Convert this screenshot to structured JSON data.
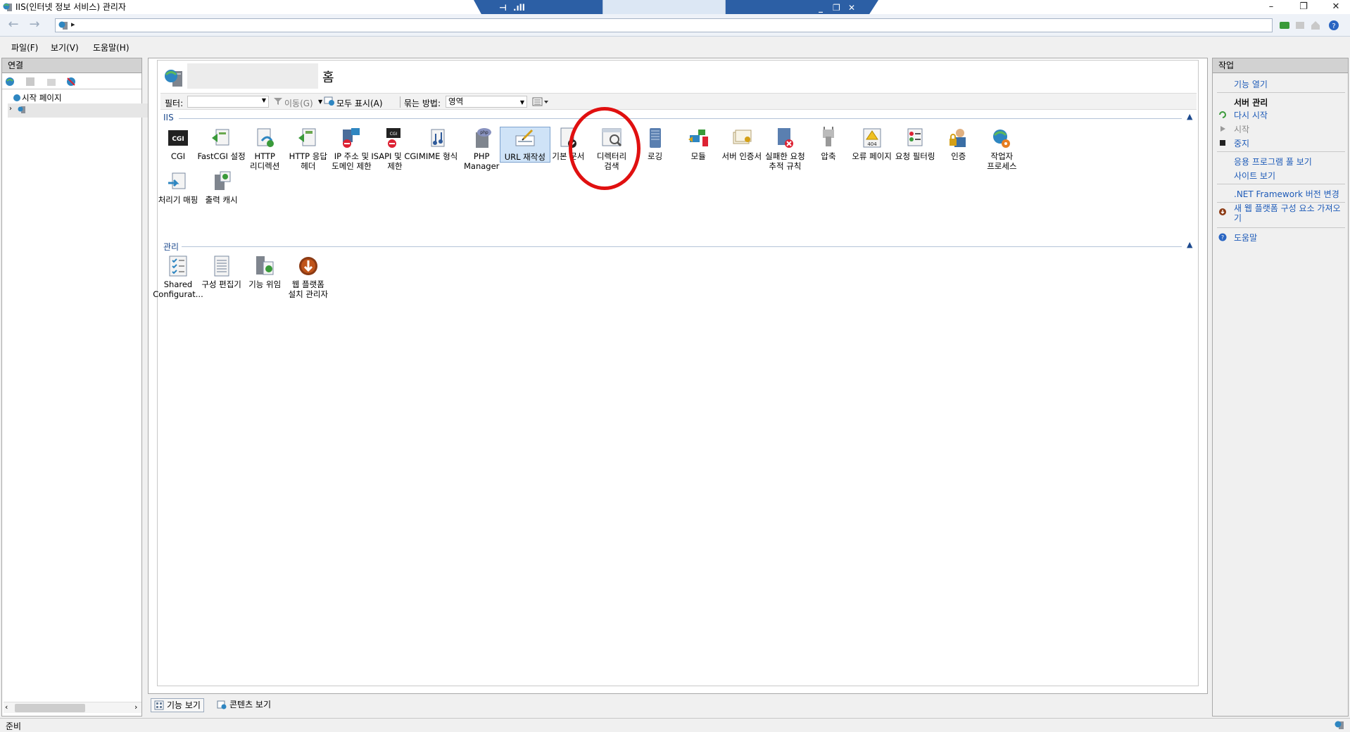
{
  "window": {
    "title": "IIS(인터넷 정보 서비스) 관리자",
    "controls": {
      "minimize": "–",
      "restore": "❐",
      "close": "✕"
    }
  },
  "rdp_bar": {
    "pin": "⊣",
    "signal": ".ıll",
    "minimize": "_",
    "restore": "❐",
    "close": "✕"
  },
  "address_bar": {
    "back": "←",
    "forward": "→",
    "breadcrumb_arrow": "▸"
  },
  "menu": {
    "items": [
      "파일(F)",
      "보기(V)",
      "도움말(H)"
    ]
  },
  "connections": {
    "header": "연결",
    "tree": {
      "start_page": "시작 페이지"
    }
  },
  "content": {
    "home_title": "홈",
    "filter": {
      "label": "필터:",
      "go": "이동(G)",
      "show_all": "모두 표시(A)",
      "group_by_label": "묶는 방법:",
      "group_by_value": "영역"
    },
    "sections": {
      "iis": "IIS",
      "management": "관리"
    },
    "iis_features": [
      {
        "label": "CGI",
        "icon": "cgi-icon"
      },
      {
        "label": "FastCGI 설정",
        "icon": "fastcgi-icon"
      },
      {
        "label": "HTTP\n리디렉션",
        "icon": "http-redirect-icon"
      },
      {
        "label": "HTTP 응답\n헤더",
        "icon": "http-response-headers-icon"
      },
      {
        "label": "IP 주소 및\n도메인 제한",
        "icon": "ip-restrictions-icon"
      },
      {
        "label": "ISAPI 및 CGI\n제한",
        "icon": "isapi-cgi-icon"
      },
      {
        "label": "MIME 형식",
        "icon": "mime-icon"
      },
      {
        "label": "PHP\nManager",
        "icon": "php-manager-icon"
      },
      {
        "label": "URL 재작성",
        "icon": "url-rewrite-icon"
      },
      {
        "label": "기본 문서",
        "icon": "default-document-icon"
      },
      {
        "label": "디렉터리\n검색",
        "icon": "directory-browsing-icon"
      },
      {
        "label": "로깅",
        "icon": "logging-icon"
      },
      {
        "label": "모듈",
        "icon": "modules-icon"
      },
      {
        "label": "서버 인증서",
        "icon": "server-certificates-icon"
      },
      {
        "label": "실패한 요청\n추적 규칙",
        "icon": "failed-request-tracing-icon"
      },
      {
        "label": "압축",
        "icon": "compression-icon"
      },
      {
        "label": "오류 페이지",
        "icon": "error-pages-icon"
      },
      {
        "label": "요청 필터링",
        "icon": "request-filtering-icon"
      },
      {
        "label": "인증",
        "icon": "authentication-icon"
      },
      {
        "label": "작업자\n프로세스",
        "icon": "worker-processes-icon"
      },
      {
        "label": "처리기 매핑",
        "icon": "handler-mappings-icon"
      },
      {
        "label": "출력 캐시",
        "icon": "output-caching-icon"
      }
    ],
    "management_features": [
      {
        "label": "Shared\nConfigurat...",
        "icon": "shared-configuration-icon"
      },
      {
        "label": "구성 편집기",
        "icon": "configuration-editor-icon"
      },
      {
        "label": "기능 위임",
        "icon": "feature-delegation-icon"
      },
      {
        "label": "웹 플랫폼\n설치 관리자",
        "icon": "web-platform-installer-icon"
      }
    ]
  },
  "view_tabs": {
    "features": "기능 보기",
    "content": "콘텐츠 보기"
  },
  "actions": {
    "header": "작업",
    "open_feature": "기능 열기",
    "server_manage": "서버 관리",
    "restart": "다시 시작",
    "start": "시작",
    "stop": "중지",
    "view_app_pools": "응용 프로그램 풀 보기",
    "view_sites": "사이트 보기",
    "change_net_version": ".NET Framework 버전 변경",
    "get_new_components": "새 웹 플랫폼 구성 요소 가져오기",
    "help": "도움말"
  },
  "status": {
    "text": "준비"
  },
  "colors": {
    "accent": "#1e5bb8",
    "highlight": "#e01010",
    "rdp_bar": "#2c5fa5"
  }
}
